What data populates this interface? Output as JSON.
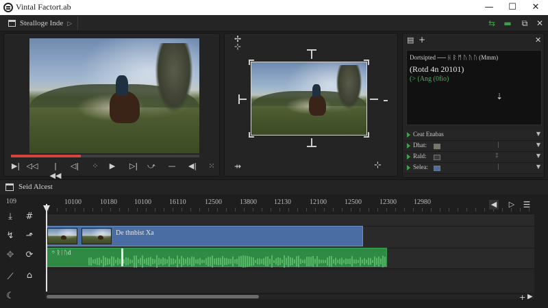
{
  "window": {
    "title": "Vintal Factort.ab",
    "controls": {
      "minimize": "—",
      "maximize": "☐",
      "close": "✕"
    }
  },
  "toolbar": {
    "tab_label": "Stealloge Inde",
    "tab_arrow": "▷",
    "tools": [
      "⇆",
      "▬",
      "⧉",
      "✕"
    ]
  },
  "source_monitor": {
    "progress": 0.37,
    "controls": [
      "▶|",
      "◁◁",
      "|◀◀",
      "◁|",
      "⁘",
      "▶",
      "▷|",
      "⤻",
      "—",
      "◀|",
      "⁙"
    ]
  },
  "program_monitor": {
    "corner_icons": [
      "✢",
      "⊹"
    ],
    "bottom_left": "⇸",
    "bottom_right": "⊹"
  },
  "inspector": {
    "header_icons": [
      "▤",
      "+",
      "✕"
    ],
    "console_lines": [
      {
        "text": "Dortsipted ── ᚺ ᛒ ᛗ ᚢ ᚢ ᚢ (Mmm)",
        "color": "#d0d0d0"
      },
      {
        "text": "(Rotd 4n 20101)",
        "color": "#e6e6e6"
      },
      {
        "text": "(>  (Ang (0fio)",
        "color": "#4db35a"
      }
    ],
    "cursor_icon": "⇣",
    "properties": [
      {
        "label": "Ceat Enabas",
        "swatch": "",
        "tick": "",
        "dropdown": "▼"
      },
      {
        "label": "Dhat:",
        "swatch": "#6f7a60",
        "tick": "|",
        "dropdown": "▼"
      },
      {
        "label": "Rald:",
        "swatch": "#3a3a3a",
        "tick": "↕",
        "dropdown": "▼"
      },
      {
        "label": "Selea:",
        "swatch": "#4a6ea3",
        "tick": "|",
        "dropdown": "▼"
      }
    ]
  },
  "timeline": {
    "title": "Seid Alcest",
    "timecode": "109",
    "ruler": [
      "10100",
      "10180",
      "10100",
      "16110",
      "12500",
      "13800",
      "12130",
      "12100",
      "12500",
      "12300",
      "12980"
    ],
    "nav_icons": [
      "◀",
      "▷",
      "☰"
    ],
    "video_clip": {
      "label": "De thnbist Xa"
    },
    "audio_clip": {
      "label": "ᛜ ᚱᛁᚢd"
    },
    "scroll_icons": [
      "+",
      "▶"
    ],
    "tools": [
      {
        "icon": "⤓",
        "name": "import-icon"
      },
      {
        "icon": "#",
        "name": "grid-icon"
      },
      {
        "icon": "↯",
        "name": "pen-icon"
      },
      {
        "icon": "⬏",
        "name": "ripple-icon"
      },
      {
        "icon": "✥",
        "name": "move-icon"
      },
      {
        "icon": "⟳",
        "name": "loop-icon"
      },
      {
        "icon": "⟋",
        "name": "curve-icon"
      },
      {
        "icon": "⌂",
        "name": "marker-icon"
      },
      {
        "icon": "☾",
        "name": "night-icon"
      }
    ]
  }
}
